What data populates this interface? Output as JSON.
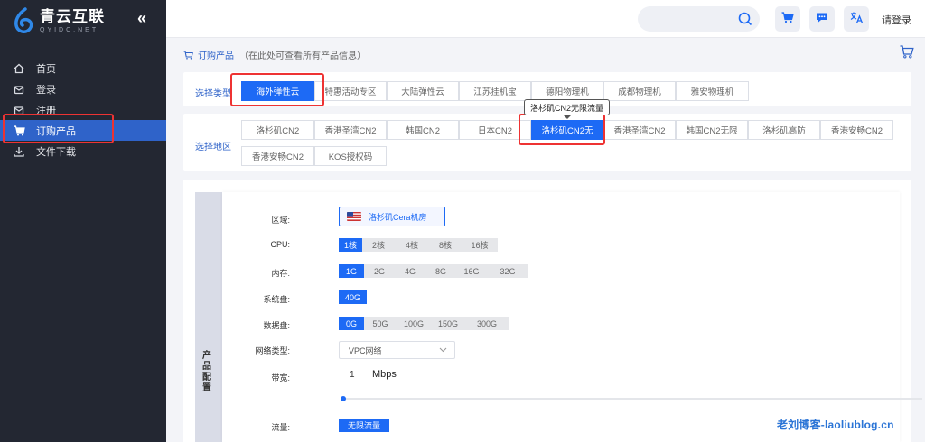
{
  "logo": {
    "title": "青云互联",
    "subtitle": "QYIDC.NET"
  },
  "sidebar": {
    "collapse": "«",
    "items": [
      {
        "label": "首页",
        "icon": "home-icon"
      },
      {
        "label": "登录",
        "icon": "login-icon"
      },
      {
        "label": "注册",
        "icon": "register-icon"
      },
      {
        "label": "订购产品",
        "icon": "cart-icon",
        "active": true
      },
      {
        "label": "文件下载",
        "icon": "download-icon"
      }
    ]
  },
  "topbar": {
    "login": "请登录"
  },
  "breadcrumb": {
    "title": "订购产品",
    "note": "（在此处可查看所有产品信息）"
  },
  "type_panel": {
    "label": "选择类型",
    "options": [
      "海外弹性云",
      "特惠活动专区",
      "大陆弹性云",
      "江苏挂机宝",
      "德阳物理机",
      "成都物理机",
      "雅安物理机"
    ]
  },
  "region_panel": {
    "label": "选择地区",
    "options": [
      "洛杉矶CN2",
      "香港圣湾CN2",
      "韩国CN2",
      "日本CN2",
      "洛杉矶CN2无",
      "香港圣湾CN2",
      "韩国CN2无限",
      "洛杉矶高防",
      "香港安畅CN2",
      "香港安畅CN2",
      "KOS授权码"
    ],
    "tooltip": "洛杉矶CN2无限流量"
  },
  "config": {
    "side_label": "产品配置",
    "region_label": "区域:",
    "region_value": "洛杉矶Cera机房",
    "cpu_label": "CPU:",
    "cpu_options": [
      "1核",
      "2核",
      "4核",
      "8核",
      "16核"
    ],
    "mem_label": "内存:",
    "mem_options": [
      "1G",
      "2G",
      "4G",
      "8G",
      "16G",
      "32G"
    ],
    "sys_label": "系统盘:",
    "sys_options": [
      "40G"
    ],
    "data_label": "数据盘:",
    "data_options": [
      "0G",
      "50G",
      "100G",
      "150G",
      "300G"
    ],
    "net_label": "网络类型:",
    "net_value": "VPC网络",
    "bw_label": "带宽:",
    "bw_value": "1",
    "bw_unit": "Mbps",
    "traffic_label": "流量:",
    "traffic_value": "无限流量"
  },
  "watermark": "老刘博客-laoliublog.cn",
  "colors": {
    "accent": "#1d6af5",
    "sidebar": "#232732",
    "highlight": "#e33333"
  }
}
